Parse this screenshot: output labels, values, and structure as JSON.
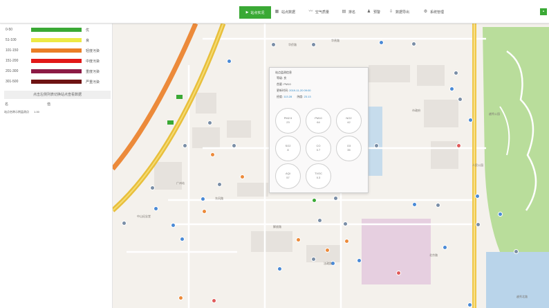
{
  "toolbar": {
    "active": {
      "label": "站点实况",
      "icon": "play-icon"
    },
    "buttons": [
      {
        "label": "站点数据",
        "icon": "table-icon"
      },
      {
        "label": "空气质量",
        "icon": "chart-icon"
      },
      {
        "label": "排名",
        "icon": "ranking-icon"
      },
      {
        "label": "预警",
        "icon": "bell-icon"
      },
      {
        "label": "数据导出",
        "icon": "export-icon"
      },
      {
        "label": "系统管理",
        "icon": "settings-icon"
      }
    ],
    "right_icon": "grid-icon"
  },
  "legend": [
    {
      "range": "0-50",
      "level": "优",
      "color": "#3aa935"
    },
    {
      "range": "51-100",
      "level": "良",
      "color": "#ecea45"
    },
    {
      "range": "101-150",
      "level": "轻度污染",
      "color": "#ea7e26"
    },
    {
      "range": "151-200",
      "level": "中度污染",
      "color": "#e21818"
    },
    {
      "range": "201-300",
      "level": "重度污染",
      "color": "#8c1a45"
    },
    {
      "range": "301-500",
      "level": "严重污染",
      "color": "#6e1313"
    }
  ],
  "left_panel": {
    "note": "点击左侧列表切换站点查看数据",
    "col_name": "名",
    "col_value": "值",
    "item_name": "站点名称示例监测点",
    "item_value": "1.00"
  },
  "popup": {
    "title": "站点监测信息",
    "lines": [
      {
        "label": "等级:",
        "value": "良"
      },
      {
        "label": "首要:",
        "value": "PM10"
      },
      {
        "label": "更新时间:",
        "value": "2019-11-20 09:00"
      },
      {
        "label": "经度:",
        "value": "113.28",
        "label2": "纬度:",
        "value2": "23.13"
      }
    ],
    "pollutants": [
      {
        "name": "PM2.5",
        "value": "23"
      },
      {
        "name": "PM10",
        "value": "64"
      },
      {
        "name": "NO2",
        "value": "42"
      },
      {
        "name": "SO2",
        "value": "8"
      },
      {
        "name": "CO",
        "value": "0.7"
      },
      {
        "name": "O3",
        "value": "35"
      },
      {
        "name": "AQI",
        "value": "57"
      },
      {
        "name": "TVOC",
        "value": "0.3"
      }
    ]
  },
  "map": {
    "labels": [
      "华侨路",
      "华贵路",
      "广州站",
      "市政府",
      "人民公园",
      "越秀公园",
      "中山纪念堂",
      "东风路",
      "解放路",
      "北京路",
      "法政路",
      "越秀北路"
    ]
  }
}
